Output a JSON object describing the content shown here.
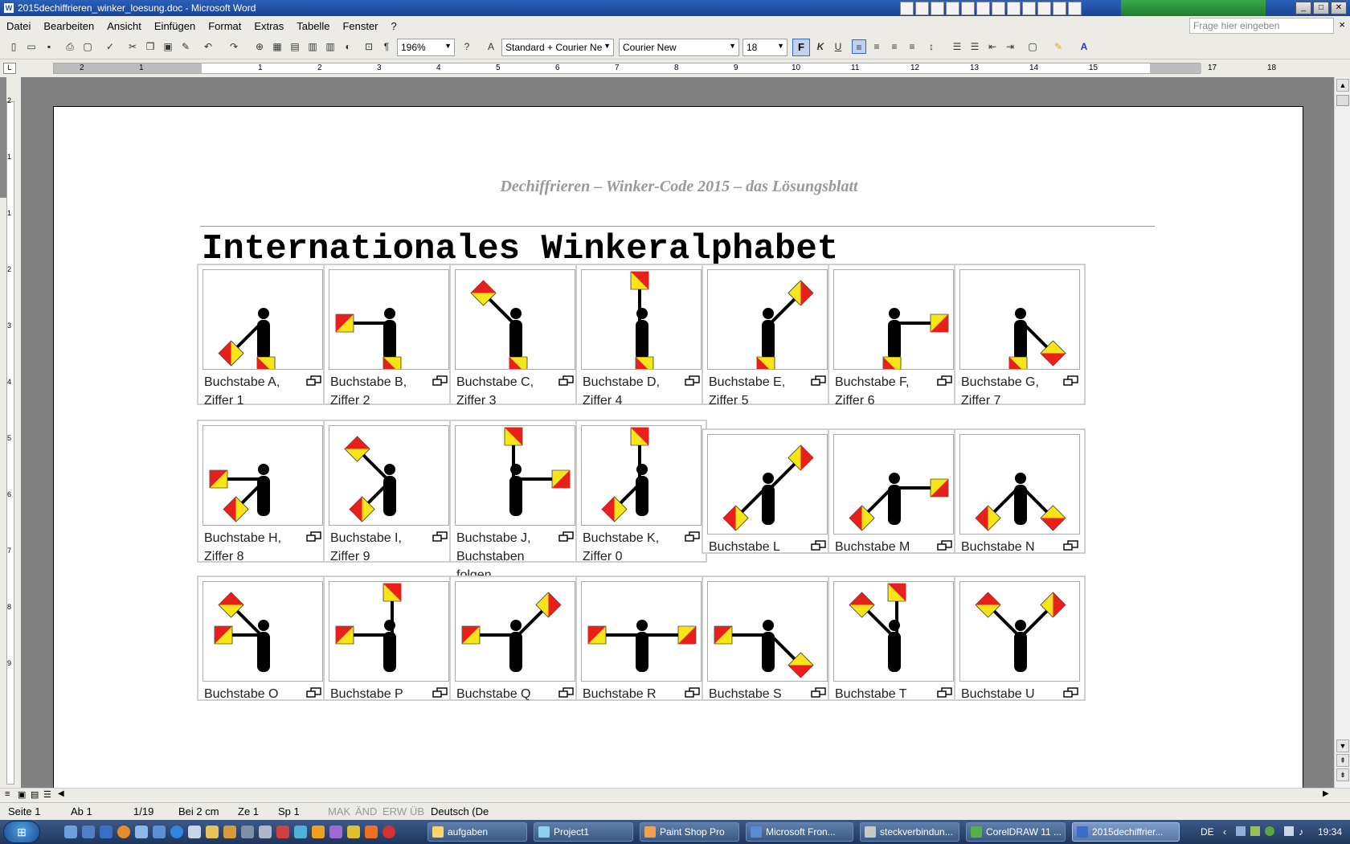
{
  "window": {
    "title": "2015dechiffrieren_winker_loesung.doc - Microsoft Word",
    "app_icon": "W"
  },
  "menu": {
    "items": [
      "Datei",
      "Bearbeiten",
      "Ansicht",
      "Einfügen",
      "Format",
      "Extras",
      "Tabelle",
      "Fenster",
      "?"
    ],
    "ask_placeholder": "Frage hier eingeben",
    "close": "×"
  },
  "toolbar": {
    "zoom": "196%",
    "style": "Standard + Courier Ne",
    "font": "Courier New",
    "size": "18",
    "bold": "F",
    "italic": "K",
    "underline": "U",
    "pilcrow": "¶"
  },
  "ruler": {
    "numbers": [
      "2",
      "1",
      "1",
      "2",
      "3",
      "4",
      "5",
      "6",
      "7",
      "8",
      "9",
      "10",
      "11",
      "12",
      "13",
      "14",
      "15",
      "17",
      "18"
    ],
    "corner": "L"
  },
  "vruler": {
    "numbers": [
      "2",
      "1",
      "1",
      "2",
      "3",
      "4",
      "5",
      "6",
      "7",
      "8",
      "9"
    ]
  },
  "document": {
    "header": "Dechiffrieren – Winker-Code 2015 – das Lösungsblatt",
    "title": "Internationales Winkeralphabet",
    "cards": [
      {
        "caption": [
          "Buchstabe A,",
          "Ziffer 1"
        ]
      },
      {
        "caption": [
          "Buchstabe B,",
          "Ziffer 2"
        ]
      },
      {
        "caption": [
          "Buchstabe C,",
          "Ziffer 3"
        ]
      },
      {
        "caption": [
          "Buchstabe D,",
          "Ziffer 4"
        ]
      },
      {
        "caption": [
          "Buchstabe E,",
          "Ziffer 5"
        ]
      },
      {
        "caption": [
          "Buchstabe F,",
          "Ziffer 6"
        ]
      },
      {
        "caption": [
          "Buchstabe G,",
          "Ziffer 7"
        ]
      },
      {
        "caption": [
          "Buchstabe H,",
          "Ziffer 8"
        ]
      },
      {
        "caption": [
          "Buchstabe I,",
          "Ziffer 9"
        ]
      },
      {
        "caption": [
          "Buchstabe J,",
          "Buchstaben folgen"
        ]
      },
      {
        "caption": [
          "Buchstabe K,",
          "Ziffer 0"
        ]
      },
      {
        "caption": [
          "Buchstabe L"
        ]
      },
      {
        "caption": [
          "Buchstabe M"
        ]
      },
      {
        "caption": [
          "Buchstabe N"
        ]
      },
      {
        "caption": [
          "Buchstabe O"
        ]
      },
      {
        "caption": [
          "Buchstabe P"
        ]
      },
      {
        "caption": [
          "Buchstabe Q"
        ]
      },
      {
        "caption": [
          "Buchstabe R"
        ]
      },
      {
        "caption": [
          "Buchstabe S"
        ]
      },
      {
        "caption": [
          "Buchstabe T"
        ]
      },
      {
        "caption": [
          "Buchstabe U"
        ]
      }
    ]
  },
  "status": {
    "page": "Seite 1",
    "section": "Ab 1",
    "pages": "1/19",
    "at": "Bei 2 cm",
    "line": "Ze 1",
    "col": "Sp 1",
    "mak": "MAK",
    "aend": "ÄND",
    "erw": "ERW",
    "ueb": "ÜB",
    "lang": "Deutsch (De"
  },
  "taskbar": {
    "tasks": [
      "aufgaben",
      "Project1",
      "Paint Shop Pro",
      "Microsoft Fron...",
      "steckverbindun...",
      "CorelDRAW 11 ...",
      "2015dechiffrier..."
    ],
    "lang": "DE",
    "clock": "19:34"
  },
  "colors": {
    "flag_red": "#e8201c",
    "flag_yellow": "#f7e51a",
    "title_blue": "#1b4497",
    "taskbar": "#2a4470"
  }
}
